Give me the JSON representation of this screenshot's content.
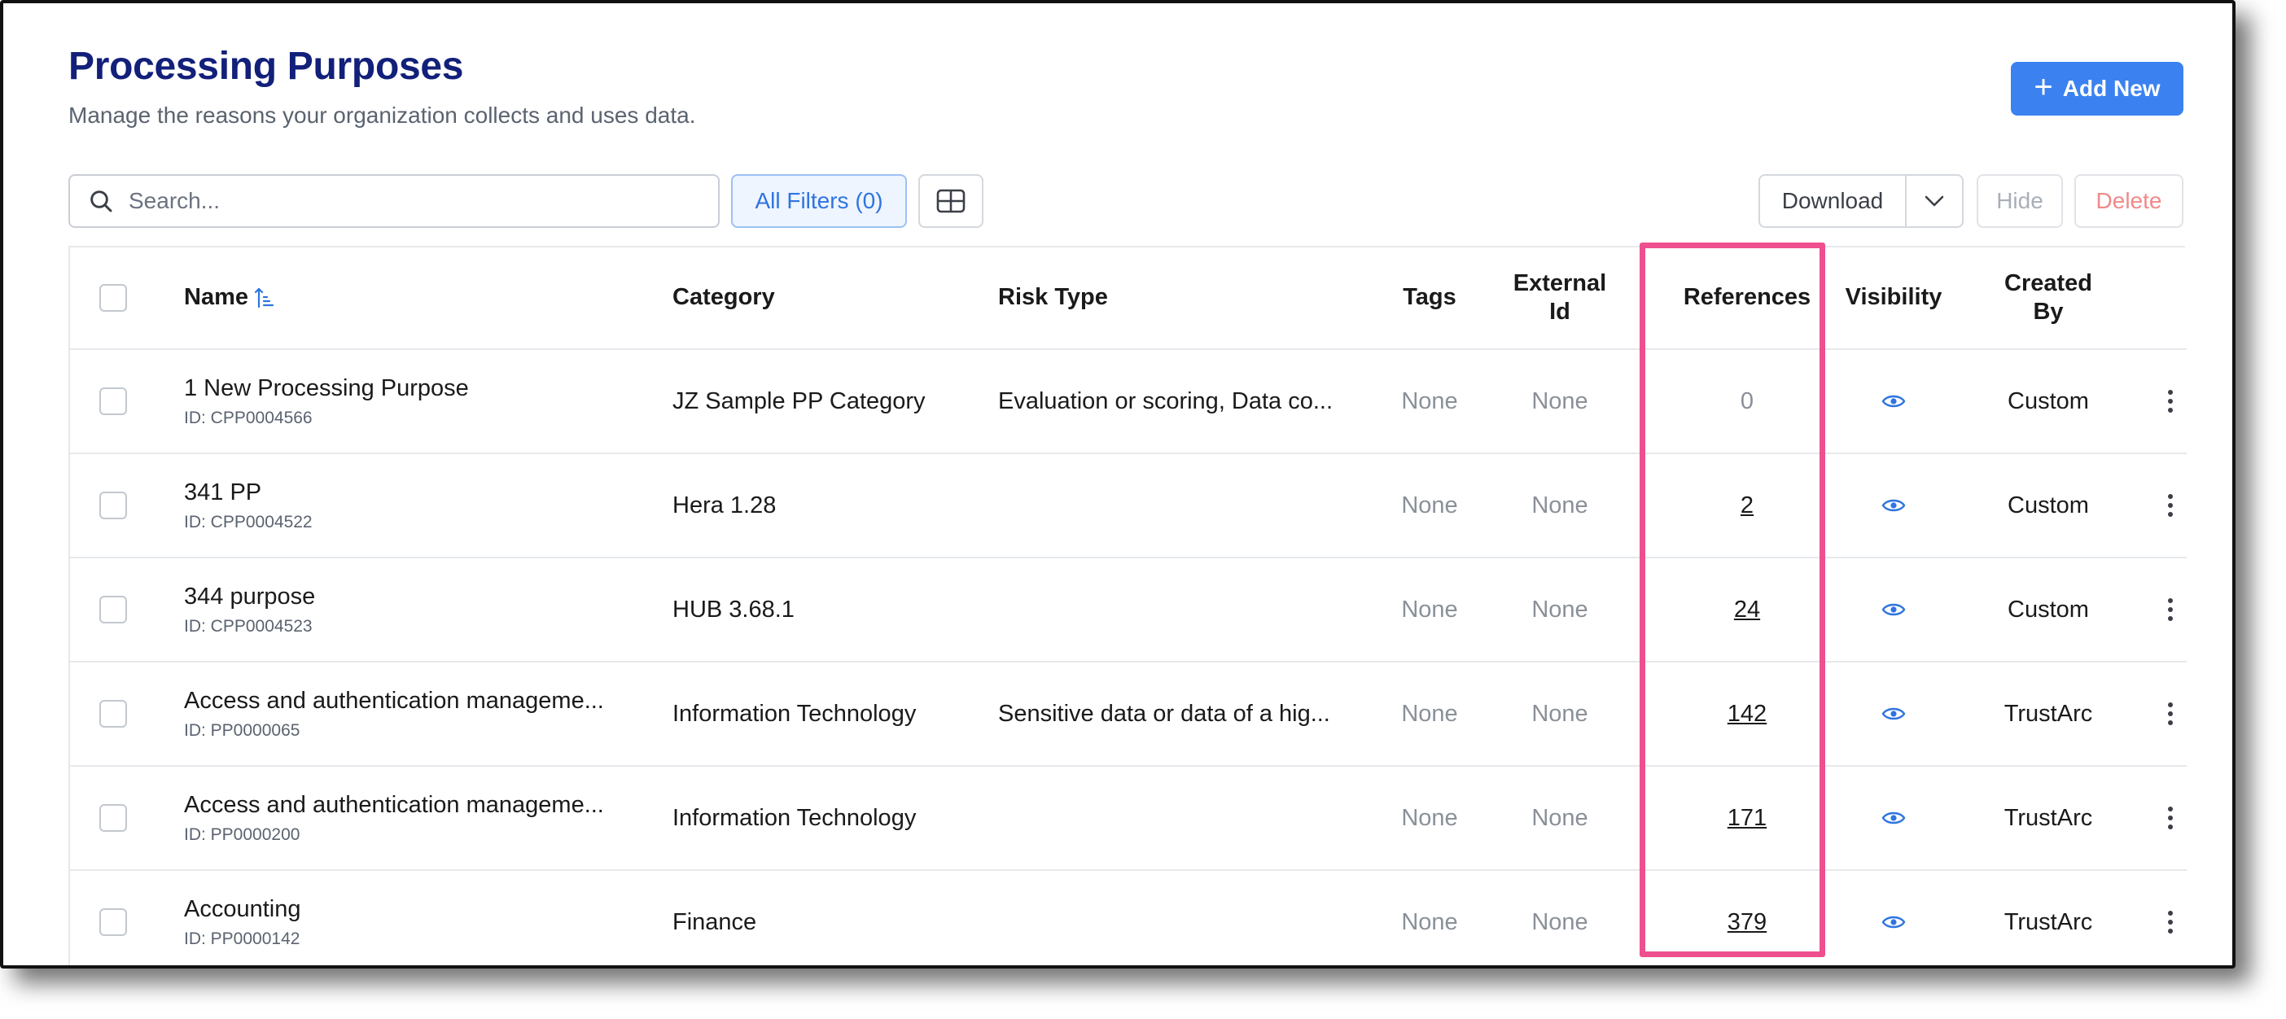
{
  "header": {
    "title": "Processing Purposes",
    "subtitle": "Manage the reasons your organization collects and uses data.",
    "add_button_label": "Add New"
  },
  "toolbar": {
    "search_placeholder": "Search...",
    "filters_label": "All Filters (0)",
    "download_label": "Download",
    "hide_label": "Hide",
    "delete_label": "Delete"
  },
  "table": {
    "columns": {
      "name": "Name",
      "category": "Category",
      "risk_type": "Risk Type",
      "tags": "Tags",
      "external_id_1": "External",
      "external_id_2": "Id",
      "references": "References",
      "visibility": "Visibility",
      "created_by_1": "Created",
      "created_by_2": "By"
    },
    "rows": [
      {
        "name": "1 New Processing Purpose",
        "id": "ID: CPP0004566",
        "category": "JZ Sample PP Category",
        "risk_type": "Evaluation or scoring, Data co...",
        "tags": "None",
        "external_id": "None",
        "references": "0",
        "created_by": "Custom"
      },
      {
        "name": "341 PP",
        "id": "ID: CPP0004522",
        "category": "Hera 1.28",
        "risk_type": "",
        "tags": "None",
        "external_id": "None",
        "references": "2",
        "created_by": "Custom"
      },
      {
        "name": "344 purpose",
        "id": "ID: CPP0004523",
        "category": "HUB 3.68.1",
        "risk_type": "",
        "tags": "None",
        "external_id": "None",
        "references": "24",
        "created_by": "Custom"
      },
      {
        "name": "Access and authentication manageme...",
        "id": "ID: PP0000065",
        "category": "Information Technology",
        "risk_type": "Sensitive data or data of a hig...",
        "tags": "None",
        "external_id": "None",
        "references": "142",
        "created_by": "TrustArc"
      },
      {
        "name": "Access and authentication manageme...",
        "id": "ID: PP0000200",
        "category": "Information Technology",
        "risk_type": "",
        "tags": "None",
        "external_id": "None",
        "references": "171",
        "created_by": "TrustArc"
      },
      {
        "name": "Accounting",
        "id": "ID: PP0000142",
        "category": "Finance",
        "risk_type": "",
        "tags": "None",
        "external_id": "None",
        "references": "379",
        "created_by": "TrustArc"
      }
    ]
  },
  "colors": {
    "title": "#12207a",
    "primary": "#3b82f0",
    "highlight": "#ee4f8e",
    "delete": "#f08a8a"
  },
  "icons": {
    "search": "search-icon",
    "columns": "grid-layout-icon",
    "sort": "sort-ascending-icon",
    "visibility": "eye-icon",
    "row_menu": "kebab-menu-icon",
    "download_menu": "chevron-down-icon",
    "add": "plus-icon"
  }
}
